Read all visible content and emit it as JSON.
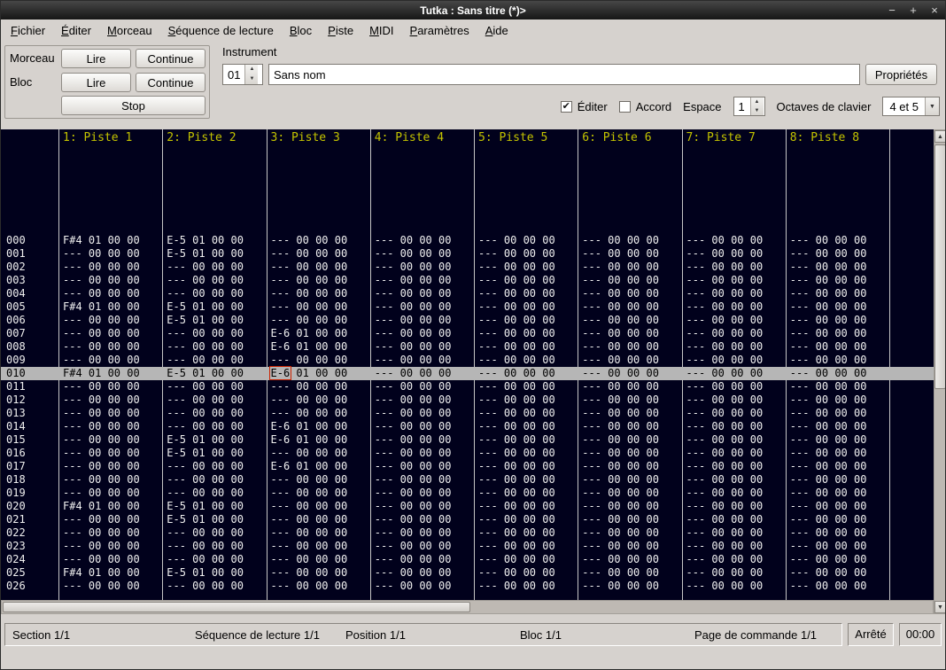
{
  "window": {
    "title": "Tutka : Sans titre (*)>",
    "minimize": "−",
    "maximize": "+",
    "close": "×"
  },
  "menu": {
    "items": [
      {
        "id": "fichier",
        "label": "Fichier"
      },
      {
        "id": "editer",
        "label": "Éditer"
      },
      {
        "id": "morceau",
        "label": "Morceau"
      },
      {
        "id": "sequence-de-lecture",
        "label": "Séquence de lecture"
      },
      {
        "id": "bloc",
        "label": "Bloc"
      },
      {
        "id": "piste",
        "label": "Piste"
      },
      {
        "id": "midi",
        "label": "MIDI"
      },
      {
        "id": "parametres",
        "label": "Paramètres"
      },
      {
        "id": "aide",
        "label": "Aide"
      }
    ]
  },
  "transport": {
    "song_label": "Morceau",
    "block_label": "Bloc",
    "song_play": "Lire",
    "song_continue": "Continue",
    "block_play": "Lire",
    "block_continue": "Continue",
    "stop": "Stop"
  },
  "instrument": {
    "label": "Instrument",
    "number": "01",
    "name": "Sans nom",
    "properties": "Propriétés"
  },
  "options": {
    "edit_label": "Éditer",
    "edit_checked": true,
    "edit_checkmark": "✔",
    "chord_label": "Accord",
    "chord_checked": false,
    "space_label": "Espace",
    "space_value": "1",
    "octaves_label": "Octaves de clavier",
    "octaves_value": "4 et 5"
  },
  "tracker": {
    "track_headers": [
      "1: Piste 1",
      "2: Piste 2",
      "3: Piste 3",
      "4: Piste 4",
      "5: Piste 5",
      "6: Piste 6",
      "7: Piste 7",
      "8: Piste 8"
    ],
    "cursor": {
      "row": 10,
      "track": 2,
      "value": "E-6"
    },
    "rows": [
      {
        "num": "000",
        "cells": [
          "F#4 01 00 00",
          "E-5 01 00 00",
          "--- 00 00 00",
          "--- 00 00 00",
          "--- 00 00 00",
          "--- 00 00 00",
          "--- 00 00 00",
          "--- 00 00 00"
        ]
      },
      {
        "num": "001",
        "cells": [
          "--- 00 00 00",
          "E-5 01 00 00",
          "--- 00 00 00",
          "--- 00 00 00",
          "--- 00 00 00",
          "--- 00 00 00",
          "--- 00 00 00",
          "--- 00 00 00"
        ]
      },
      {
        "num": "002",
        "cells": [
          "--- 00 00 00",
          "--- 00 00 00",
          "--- 00 00 00",
          "--- 00 00 00",
          "--- 00 00 00",
          "--- 00 00 00",
          "--- 00 00 00",
          "--- 00 00 00"
        ]
      },
      {
        "num": "003",
        "cells": [
          "--- 00 00 00",
          "--- 00 00 00",
          "--- 00 00 00",
          "--- 00 00 00",
          "--- 00 00 00",
          "--- 00 00 00",
          "--- 00 00 00",
          "--- 00 00 00"
        ]
      },
      {
        "num": "004",
        "cells": [
          "--- 00 00 00",
          "--- 00 00 00",
          "--- 00 00 00",
          "--- 00 00 00",
          "--- 00 00 00",
          "--- 00 00 00",
          "--- 00 00 00",
          "--- 00 00 00"
        ]
      },
      {
        "num": "005",
        "cells": [
          "F#4 01 00 00",
          "E-5 01 00 00",
          "--- 00 00 00",
          "--- 00 00 00",
          "--- 00 00 00",
          "--- 00 00 00",
          "--- 00 00 00",
          "--- 00 00 00"
        ]
      },
      {
        "num": "006",
        "cells": [
          "--- 00 00 00",
          "E-5 01 00 00",
          "--- 00 00 00",
          "--- 00 00 00",
          "--- 00 00 00",
          "--- 00 00 00",
          "--- 00 00 00",
          "--- 00 00 00"
        ]
      },
      {
        "num": "007",
        "cells": [
          "--- 00 00 00",
          "--- 00 00 00",
          "E-6 01 00 00",
          "--- 00 00 00",
          "--- 00 00 00",
          "--- 00 00 00",
          "--- 00 00 00",
          "--- 00 00 00"
        ]
      },
      {
        "num": "008",
        "cells": [
          "--- 00 00 00",
          "--- 00 00 00",
          "E-6 01 00 00",
          "--- 00 00 00",
          "--- 00 00 00",
          "--- 00 00 00",
          "--- 00 00 00",
          "--- 00 00 00"
        ]
      },
      {
        "num": "009",
        "cells": [
          "--- 00 00 00",
          "--- 00 00 00",
          "--- 00 00 00",
          "--- 00 00 00",
          "--- 00 00 00",
          "--- 00 00 00",
          "--- 00 00 00",
          "--- 00 00 00"
        ]
      },
      {
        "num": "010",
        "cells": [
          "F#4 01 00 00",
          "E-5 01 00 00",
          "E-6 01 00 00",
          "--- 00 00 00",
          "--- 00 00 00",
          "--- 00 00 00",
          "--- 00 00 00",
          "--- 00 00 00"
        ]
      },
      {
        "num": "011",
        "cells": [
          "--- 00 00 00",
          "--- 00 00 00",
          "--- 00 00 00",
          "--- 00 00 00",
          "--- 00 00 00",
          "--- 00 00 00",
          "--- 00 00 00",
          "--- 00 00 00"
        ]
      },
      {
        "num": "012",
        "cells": [
          "--- 00 00 00",
          "--- 00 00 00",
          "--- 00 00 00",
          "--- 00 00 00",
          "--- 00 00 00",
          "--- 00 00 00",
          "--- 00 00 00",
          "--- 00 00 00"
        ]
      },
      {
        "num": "013",
        "cells": [
          "--- 00 00 00",
          "--- 00 00 00",
          "--- 00 00 00",
          "--- 00 00 00",
          "--- 00 00 00",
          "--- 00 00 00",
          "--- 00 00 00",
          "--- 00 00 00"
        ]
      },
      {
        "num": "014",
        "cells": [
          "--- 00 00 00",
          "--- 00 00 00",
          "E-6 01 00 00",
          "--- 00 00 00",
          "--- 00 00 00",
          "--- 00 00 00",
          "--- 00 00 00",
          "--- 00 00 00"
        ]
      },
      {
        "num": "015",
        "cells": [
          "--- 00 00 00",
          "E-5 01 00 00",
          "E-6 01 00 00",
          "--- 00 00 00",
          "--- 00 00 00",
          "--- 00 00 00",
          "--- 00 00 00",
          "--- 00 00 00"
        ]
      },
      {
        "num": "016",
        "cells": [
          "--- 00 00 00",
          "E-5 01 00 00",
          "--- 00 00 00",
          "--- 00 00 00",
          "--- 00 00 00",
          "--- 00 00 00",
          "--- 00 00 00",
          "--- 00 00 00"
        ]
      },
      {
        "num": "017",
        "cells": [
          "--- 00 00 00",
          "--- 00 00 00",
          "E-6 01 00 00",
          "--- 00 00 00",
          "--- 00 00 00",
          "--- 00 00 00",
          "--- 00 00 00",
          "--- 00 00 00"
        ]
      },
      {
        "num": "018",
        "cells": [
          "--- 00 00 00",
          "--- 00 00 00",
          "--- 00 00 00",
          "--- 00 00 00",
          "--- 00 00 00",
          "--- 00 00 00",
          "--- 00 00 00",
          "--- 00 00 00"
        ]
      },
      {
        "num": "019",
        "cells": [
          "--- 00 00 00",
          "--- 00 00 00",
          "--- 00 00 00",
          "--- 00 00 00",
          "--- 00 00 00",
          "--- 00 00 00",
          "--- 00 00 00",
          "--- 00 00 00"
        ]
      },
      {
        "num": "020",
        "cells": [
          "F#4 01 00 00",
          "E-5 01 00 00",
          "--- 00 00 00",
          "--- 00 00 00",
          "--- 00 00 00",
          "--- 00 00 00",
          "--- 00 00 00",
          "--- 00 00 00"
        ]
      },
      {
        "num": "021",
        "cells": [
          "--- 00 00 00",
          "E-5 01 00 00",
          "--- 00 00 00",
          "--- 00 00 00",
          "--- 00 00 00",
          "--- 00 00 00",
          "--- 00 00 00",
          "--- 00 00 00"
        ]
      },
      {
        "num": "022",
        "cells": [
          "--- 00 00 00",
          "--- 00 00 00",
          "--- 00 00 00",
          "--- 00 00 00",
          "--- 00 00 00",
          "--- 00 00 00",
          "--- 00 00 00",
          "--- 00 00 00"
        ]
      },
      {
        "num": "023",
        "cells": [
          "--- 00 00 00",
          "--- 00 00 00",
          "--- 00 00 00",
          "--- 00 00 00",
          "--- 00 00 00",
          "--- 00 00 00",
          "--- 00 00 00",
          "--- 00 00 00"
        ]
      },
      {
        "num": "024",
        "cells": [
          "--- 00 00 00",
          "--- 00 00 00",
          "--- 00 00 00",
          "--- 00 00 00",
          "--- 00 00 00",
          "--- 00 00 00",
          "--- 00 00 00",
          "--- 00 00 00"
        ]
      },
      {
        "num": "025",
        "cells": [
          "F#4 01 00 00",
          "E-5 01 00 00",
          "--- 00 00 00",
          "--- 00 00 00",
          "--- 00 00 00",
          "--- 00 00 00",
          "--- 00 00 00",
          "--- 00 00 00"
        ]
      },
      {
        "num": "026",
        "cells": [
          "--- 00 00 00",
          "--- 00 00 00",
          "--- 00 00 00",
          "--- 00 00 00",
          "--- 00 00 00",
          "--- 00 00 00",
          "--- 00 00 00",
          "--- 00 00 00"
        ]
      }
    ]
  },
  "statusbar": {
    "section": "Section 1/1",
    "sequence": "Séquence de lecture 1/1",
    "position": "Position 1/1",
    "block": "Bloc 1/1",
    "command_page": "Page de commande 1/1",
    "state": "Arrêté",
    "time": "00:00"
  },
  "colors": {
    "tracker_bg": "#01011c",
    "header_text": "#c4c400",
    "note_text": "#f0f0f0",
    "highlight_bg": "#b6b6b6",
    "cursor_outline": "#cc2200"
  }
}
